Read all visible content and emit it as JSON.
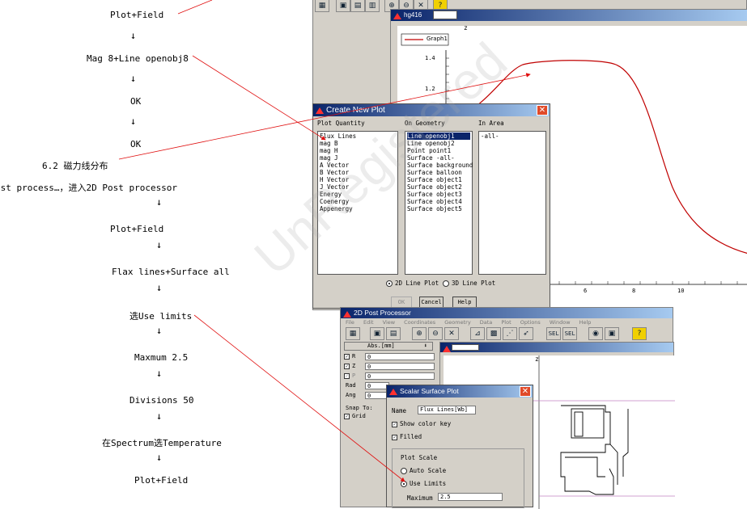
{
  "steps": [
    "Plot+Field",
    "Mag 8+Line openobj8",
    "OK",
    "OK",
    "6.2 磁力线分布",
    "ost process…，进入2D Post processor",
    "Plot+Field",
    "Flax lines+Surface all",
    "选Use limits",
    "Maxmum 2.5",
    "Divisions 50",
    "在Spectrum选Temperature",
    "Plot+Field"
  ],
  "arrow_glyph": "↓",
  "plot_window": {
    "title": "hg416",
    "legend": "Graph1",
    "axis_z": "z",
    "y_ticks": [
      "1.4",
      "1.2"
    ],
    "x_ticks": [
      "6",
      "8",
      "10"
    ],
    "curve_color": "#c00000"
  },
  "create_plot": {
    "title": "Create New Plot",
    "col_quantity": "Plot Quantity",
    "col_geometry": "On Geometry",
    "col_area": "In Area",
    "quantities": [
      "Flux Lines",
      "mag B",
      "mag H",
      "mag J",
      "A Vector",
      "B Vector",
      "H Vector",
      "J Vector",
      "Energy",
      "Coenergy",
      "Appenergy"
    ],
    "geometries": [
      "Line openobj1",
      "Line openobj2",
      "Point point1",
      "Surface -all-",
      "Surface background",
      "Surface balloon",
      "Surface object1",
      "Surface object2",
      "Surface object3",
      "Surface object4",
      "Surface object5"
    ],
    "areas": [
      "-all-"
    ],
    "selected_geometry": 0,
    "radio_2d": "2D Line Plot",
    "radio_3d": "3D Line Plot",
    "ok": "OK",
    "cancel": "Cancel",
    "help": "Help"
  },
  "post_processor": {
    "title": "2D Post Processor",
    "menu": [
      "File",
      "Edit",
      "View",
      "Coordinates",
      "Geometry",
      "Data",
      "Plot",
      "Options",
      "Window",
      "Help"
    ],
    "coord_header": "Abs.[mm]",
    "coords": [
      {
        "label": "R",
        "value": "0",
        "checked": "✓"
      },
      {
        "label": "Z",
        "value": "0",
        "checked": "✓"
      },
      {
        "label": "P",
        "value": "0",
        "checked": "✓"
      },
      {
        "label": "Rad",
        "value": "0",
        "checked": ""
      },
      {
        "label": "Ang",
        "value": "0",
        "checked": ""
      }
    ],
    "snap_to": "Snap To:",
    "grid": "Grid",
    "axis_z": "z"
  },
  "scalar_dialog": {
    "title": "Scalar Surface Plot",
    "name_label": "Name",
    "name_value": "Flux Lines[Wb]",
    "show_color_key": "Show color key",
    "filled": "Filled",
    "plot_scale": "Plot Scale",
    "auto_scale": "Auto Scale",
    "use_limits": "Use Limits",
    "maximum_label": "Maximum",
    "maximum_value": "2.5"
  },
  "watermark": "UnRegistered",
  "colors": {
    "annotation_line": "#e01010",
    "title_bar": "#0a246a"
  }
}
